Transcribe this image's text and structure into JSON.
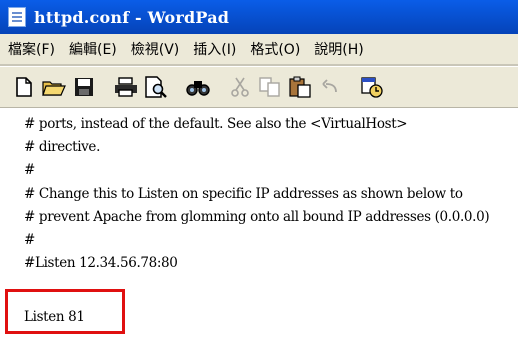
{
  "window": {
    "title": "httpd.conf - WordPad"
  },
  "menu": [
    {
      "label": "檔案(F)"
    },
    {
      "label": "編輯(E)"
    },
    {
      "label": "檢視(V)"
    },
    {
      "label": "插入(I)"
    },
    {
      "label": "格式(O)"
    },
    {
      "label": "說明(H)"
    }
  ],
  "toolbar": {
    "icons": [
      "new-document-icon",
      "open-folder-icon",
      "save-icon",
      "print-icon",
      "print-preview-icon",
      "find-icon",
      "cut-icon",
      "copy-icon",
      "paste-icon",
      "undo-icon",
      "insert-datetime-icon"
    ]
  },
  "document": {
    "lines": [
      "# ports, instead of the default. See also the <VirtualHost>",
      "# directive.",
      "#",
      "# Change this to Listen on specific IP addresses as shown below to",
      "# prevent Apache from glomming onto all bound IP addresses (0.0.0.0)",
      "#",
      "#Listen 12.34.56.78:80",
      "Listen 81"
    ]
  },
  "highlight": {
    "color": "#e01010"
  }
}
